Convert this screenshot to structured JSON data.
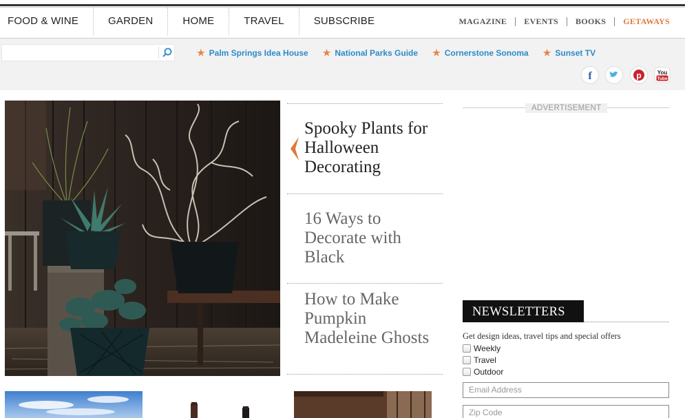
{
  "main_nav": [
    "FOOD & WINE",
    "GARDEN",
    "HOME",
    "TRAVEL",
    "SUBSCRIBE"
  ],
  "secondary_nav": [
    "MAGAZINE",
    "EVENTS",
    "BOOKS",
    "GETAWAYS"
  ],
  "search": {
    "placeholder": "",
    "value": ""
  },
  "featured_links": [
    "Palm Springs Idea House",
    "National Parks Guide",
    "Cornerstone Sonoma",
    "Sunset TV"
  ],
  "social_icons": [
    "facebook-icon",
    "twitter-icon",
    "pinterest-icon",
    "youtube-icon"
  ],
  "headlines": [
    "Spooky Plants for Halloween Decorating",
    "16 Ways to Decorate with Black",
    "How to Make Pumpkin Madeleine Ghosts"
  ],
  "advertisement_label": "ADVERTISEMENT",
  "newsletter": {
    "title": "NEWSLETTERS",
    "description": "Get design ideas, travel tips and special offers",
    "options": [
      "Weekly",
      "Travel",
      "Outdoor"
    ],
    "email_placeholder": "Email Address",
    "zip_placeholder": "Zip Code"
  },
  "colors": {
    "accent": "#e07a3a",
    "link": "#2a8bc9",
    "band": "#f2f2f2"
  }
}
